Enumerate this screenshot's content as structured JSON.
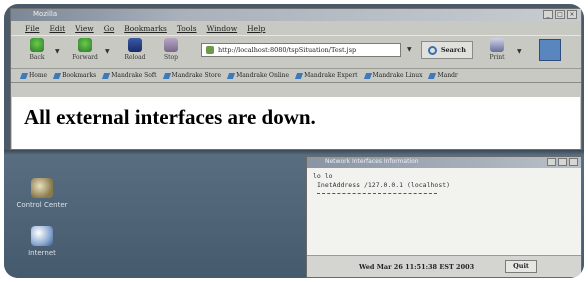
{
  "browser": {
    "title": "Mozilla",
    "window_controls": [
      "_",
      "□",
      "×"
    ],
    "menu": [
      "File",
      "Edit",
      "View",
      "Go",
      "Bookmarks",
      "Tools",
      "Window",
      "Help"
    ],
    "toolbar": {
      "back": "Back",
      "forward": "Forward",
      "reload": "Reload",
      "stop": "Stop",
      "url": "http://localhost:8080/tspSituation/Test.jsp",
      "search": "Search",
      "print": "Print"
    },
    "bookmarks": [
      "Home",
      "Bookmarks",
      "Mandrake Soft",
      "Mandrake Store",
      "Mandrake Online",
      "Mandrake Expert",
      "Mandrake Linux",
      "Mandr"
    ],
    "headline": "All external interfaces are down."
  },
  "desktop": {
    "icons": [
      {
        "label": "Control Center"
      },
      {
        "label": "Internet"
      }
    ]
  },
  "popup": {
    "title": "Network Interfaces Information",
    "line1": "lo lo",
    "line2": "InetAddress /127.0.0.1 (localhost)",
    "datetime": "Wed Mar 26 11:51:38 EST 2003",
    "quit": "Quit"
  },
  "colors": {
    "desktop": "#4e6276",
    "window_chrome": "#c9c9c4",
    "titlebar": "#7b8796",
    "accent": "#3f7ab8"
  }
}
